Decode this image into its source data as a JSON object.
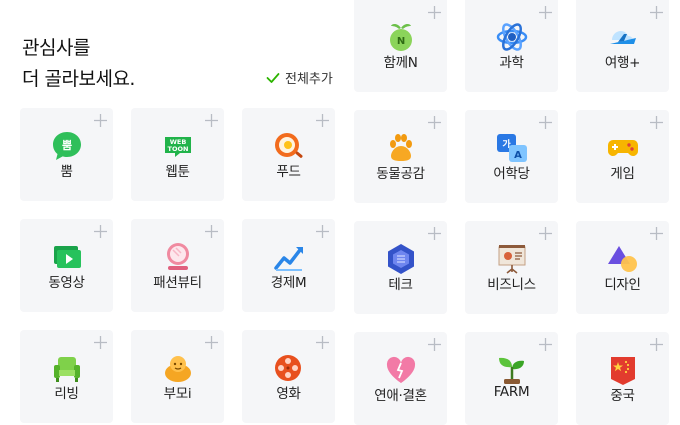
{
  "heading": {
    "line1": "관심사를",
    "line2": "더 골라보세요."
  },
  "add_all": {
    "label": "전체추가",
    "icon": "check-icon",
    "color": "#2db400"
  },
  "topics": [
    {
      "label": "함께N",
      "icon": "sprout-character-icon"
    },
    {
      "label": "과학",
      "icon": "atom-icon"
    },
    {
      "label": "여행+",
      "icon": "airplane-icon"
    },
    {
      "label": "뿜",
      "icon": "bbum-speech-bubble-icon"
    },
    {
      "label": "웹툰",
      "icon": "webtoon-logo-icon"
    },
    {
      "label": "푸드",
      "icon": "frying-pan-egg-icon"
    },
    {
      "label": "동물공감",
      "icon": "paw-icon"
    },
    {
      "label": "어학당",
      "icon": "language-icon"
    },
    {
      "label": "게임",
      "icon": "gamepad-icon"
    },
    {
      "label": "동영상",
      "icon": "video-play-icon"
    },
    {
      "label": "패션뷰티",
      "icon": "mirror-icon"
    },
    {
      "label": "경제M",
      "icon": "trend-chart-icon"
    },
    {
      "label": "테크",
      "icon": "chip-icon"
    },
    {
      "label": "비즈니스",
      "icon": "presentation-board-icon"
    },
    {
      "label": "디자인",
      "icon": "shapes-icon"
    },
    {
      "label": "리빙",
      "icon": "armchair-icon"
    },
    {
      "label": "부모i",
      "icon": "baby-icon"
    },
    {
      "label": "영화",
      "icon": "film-reel-icon"
    },
    {
      "label": "연애·결혼",
      "icon": "heart-icon"
    },
    {
      "label": "FARM",
      "icon": "seedling-icon"
    },
    {
      "label": "중국",
      "icon": "china-flag-icon"
    }
  ]
}
